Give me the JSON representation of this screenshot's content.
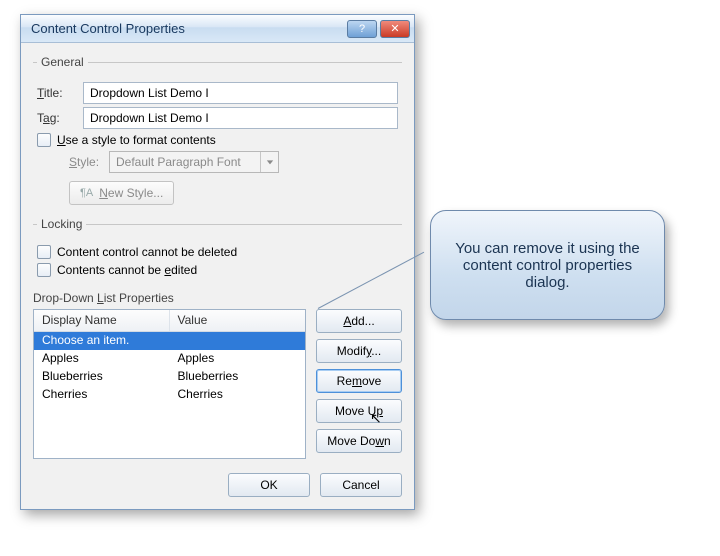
{
  "dialog": {
    "title": "Content Control Properties",
    "general": {
      "legend": "General",
      "title_label": "Title:",
      "title_value": "Dropdown List Demo I",
      "tag_label": "Tag:",
      "tag_value": "Dropdown List Demo I",
      "use_style_label": "Use a style to format contents",
      "style_label": "Style:",
      "style_value": "Default Paragraph Font",
      "new_style_label": "New Style..."
    },
    "locking": {
      "legend": "Locking",
      "cannot_delete": "Content control cannot be deleted",
      "cannot_edit": "Contents cannot be edited"
    },
    "dropdown": {
      "section_label": "Drop-Down List Properties",
      "col_display": "Display Name",
      "col_value": "Value",
      "rows": [
        {
          "display": "Choose an item.",
          "value": "",
          "selected": true
        },
        {
          "display": "Apples",
          "value": "Apples",
          "selected": false
        },
        {
          "display": "Blueberries",
          "value": "Blueberries",
          "selected": false
        },
        {
          "display": "Cherries",
          "value": "Cherries",
          "selected": false
        }
      ],
      "buttons": {
        "add": "Add...",
        "modify": "Modify...",
        "remove": "Remove",
        "moveup": "Move Up",
        "movedown": "Move Down"
      }
    },
    "footer": {
      "ok": "OK",
      "cancel": "Cancel"
    }
  },
  "callout": {
    "text": "You can remove it using the content control properties dialog."
  }
}
